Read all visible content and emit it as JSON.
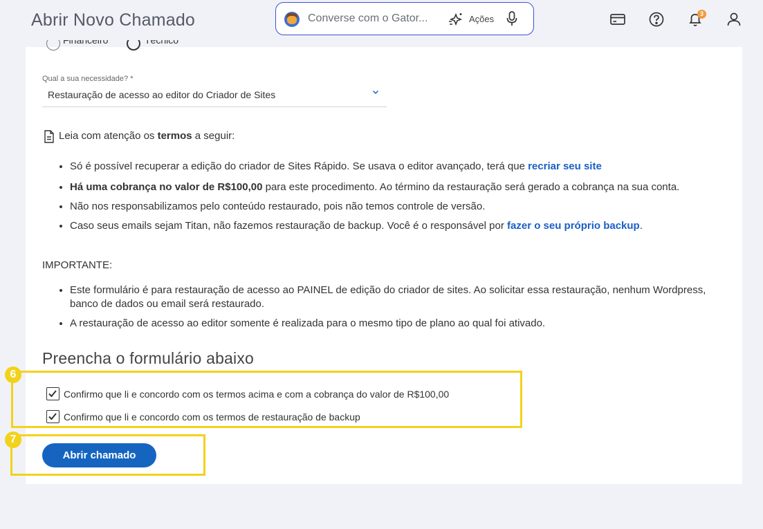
{
  "header": {
    "title": "Abrir Novo Chamado",
    "chat_placeholder": "Converse com o Gator...",
    "actions_label": "Ações",
    "notification_count": "3"
  },
  "form": {
    "radio_options": [
      "Financeiro",
      "Técnico"
    ],
    "need_label": "Qual a sua necessidade? *",
    "need_value": "Restauração de acesso ao editor do Criador de Sites",
    "terms_intro_pre": "Leia com atenção os ",
    "terms_intro_bold": "termos",
    "terms_intro_post": " a seguir:",
    "terms": {
      "t1_text": "Só é possível recuperar a edição do criador de Sites Rápido. Se usava o editor avançado, terá que ",
      "t1_link": "recriar seu site",
      "t2_bold": "Há uma cobrança no valor de R$100,00",
      "t2_text": " para este procedimento. Ao término da restauração será gerado a cobrança na sua conta.",
      "t3_text": "Não nos responsabilizamos pelo conteúdo restaurado, pois não temos controle de versão.",
      "t4_text": "Caso seus emails sejam Titan, não fazemos restauração de backup. Você é o responsável por ",
      "t4_link": "fazer o seu próprio backup",
      "t4_end": "."
    },
    "important_label": "IMPORTANTE:",
    "important_items": [
      "Este formulário é para restauração de acesso ao PAINEL de edição do criador de sites. Ao solicitar essa restauração, nenhum Wordpress, banco de dados ou email será restaurado.",
      "A restauração de acesso ao editor somente é realizada para o mesmo tipo de plano ao qual foi ativado."
    ],
    "form_heading": "Preencha o formulário abaixo",
    "checkbox_1": "Confirmo que li e concordo com os termos acima e com a cobrança do valor de R$100,00",
    "checkbox_2": "Confirmo que li e concordo com os termos de restauração de backup",
    "submit_label": "Abrir chamado"
  },
  "annotations": {
    "step_6": "6",
    "step_7": "7",
    "highlight_color": "#f2d21b"
  },
  "colors": {
    "primary": "#1565c0",
    "link": "#1a5fc4",
    "background": "#f1f2f7"
  }
}
